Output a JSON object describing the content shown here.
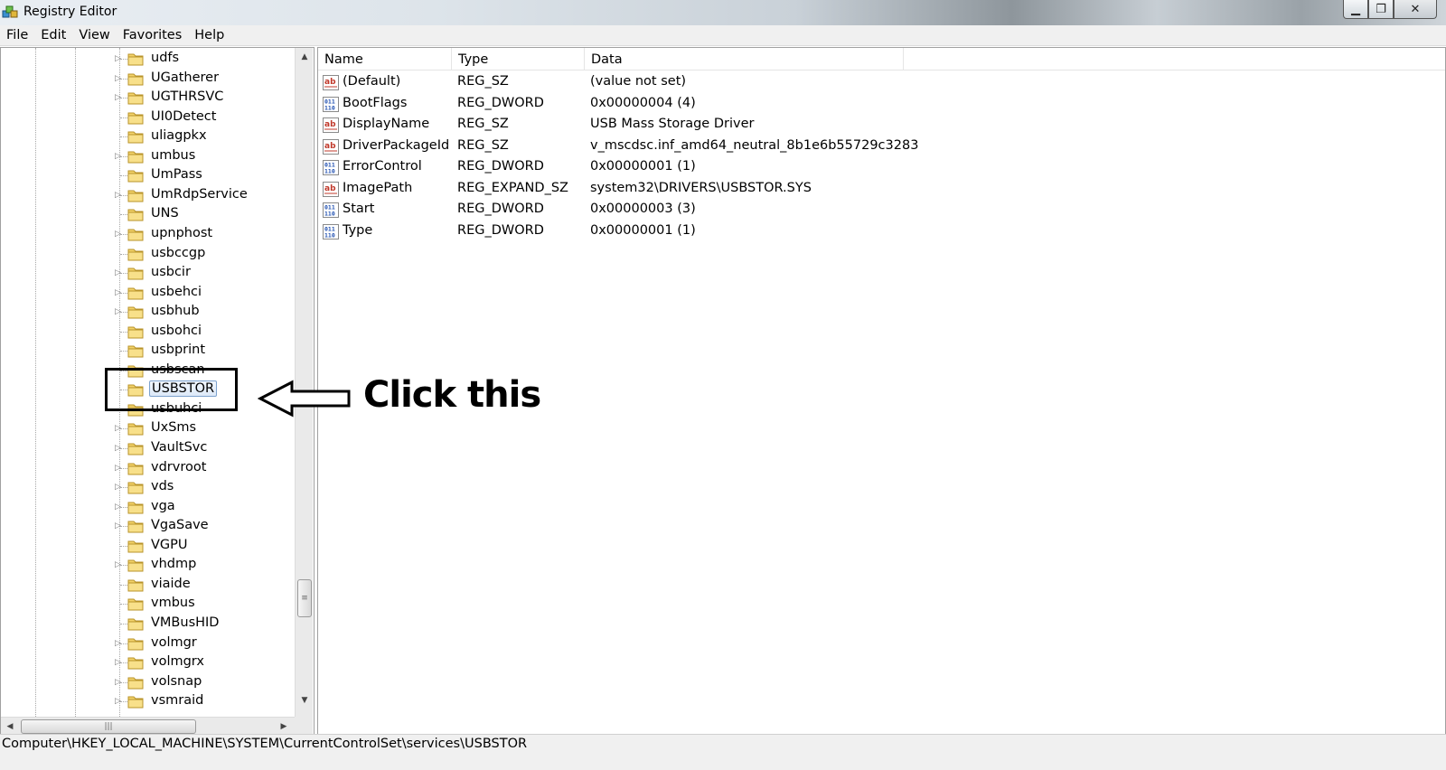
{
  "window": {
    "title": "Registry Editor"
  },
  "menu": [
    "File",
    "Edit",
    "View",
    "Favorites",
    "Help"
  ],
  "tree": {
    "items": [
      {
        "label": "udfs",
        "expandable": true
      },
      {
        "label": "UGatherer",
        "expandable": true
      },
      {
        "label": "UGTHRSVC",
        "expandable": true
      },
      {
        "label": "UI0Detect",
        "expandable": false
      },
      {
        "label": "uliagpkx",
        "expandable": false
      },
      {
        "label": "umbus",
        "expandable": true
      },
      {
        "label": "UmPass",
        "expandable": false
      },
      {
        "label": "UmRdpService",
        "expandable": true
      },
      {
        "label": "UNS",
        "expandable": false
      },
      {
        "label": "upnphost",
        "expandable": true
      },
      {
        "label": "usbccgp",
        "expandable": false
      },
      {
        "label": "usbcir",
        "expandable": true
      },
      {
        "label": "usbehci",
        "expandable": true
      },
      {
        "label": "usbhub",
        "expandable": true
      },
      {
        "label": "usbohci",
        "expandable": false
      },
      {
        "label": "usbprint",
        "expandable": false
      },
      {
        "label": "usbscan",
        "expandable": false
      },
      {
        "label": "USBSTOR",
        "expandable": false,
        "selected": true
      },
      {
        "label": "usbuhci",
        "expandable": false
      },
      {
        "label": "UxSms",
        "expandable": true
      },
      {
        "label": "VaultSvc",
        "expandable": true
      },
      {
        "label": "vdrvroot",
        "expandable": true
      },
      {
        "label": "vds",
        "expandable": true
      },
      {
        "label": "vga",
        "expandable": true
      },
      {
        "label": "VgaSave",
        "expandable": true
      },
      {
        "label": "VGPU",
        "expandable": false
      },
      {
        "label": "vhdmp",
        "expandable": true
      },
      {
        "label": "viaide",
        "expandable": false
      },
      {
        "label": "vmbus",
        "expandable": false
      },
      {
        "label": "VMBusHID",
        "expandable": false
      },
      {
        "label": "volmgr",
        "expandable": true
      },
      {
        "label": "volmgrx",
        "expandable": true
      },
      {
        "label": "volsnap",
        "expandable": true
      },
      {
        "label": "vsmraid",
        "expandable": true
      }
    ]
  },
  "values": {
    "columns": [
      "Name",
      "Type",
      "Data"
    ],
    "rows": [
      {
        "kind": "string",
        "name": "(Default)",
        "type": "REG_SZ",
        "data": "(value not set)"
      },
      {
        "kind": "binary",
        "name": "BootFlags",
        "type": "REG_DWORD",
        "data": "0x00000004 (4)"
      },
      {
        "kind": "string",
        "name": "DisplayName",
        "type": "REG_SZ",
        "data": "USB Mass Storage Driver"
      },
      {
        "kind": "string",
        "name": "DriverPackageId",
        "type": "REG_SZ",
        "data": "v_mscdsc.inf_amd64_neutral_8b1e6b55729c3283"
      },
      {
        "kind": "binary",
        "name": "ErrorControl",
        "type": "REG_DWORD",
        "data": "0x00000001 (1)"
      },
      {
        "kind": "string",
        "name": "ImagePath",
        "type": "REG_EXPAND_SZ",
        "data": "system32\\DRIVERS\\USBSTOR.SYS"
      },
      {
        "kind": "binary",
        "name": "Start",
        "type": "REG_DWORD",
        "data": "0x00000003 (3)"
      },
      {
        "kind": "binary",
        "name": "Type",
        "type": "REG_DWORD",
        "data": "0x00000001 (1)"
      }
    ]
  },
  "annotation": {
    "text": "Click this"
  },
  "status": {
    "path": "Computer\\HKEY_LOCAL_MACHINE\\SYSTEM\\CurrentControlSet\\services\\USBSTOR"
  }
}
